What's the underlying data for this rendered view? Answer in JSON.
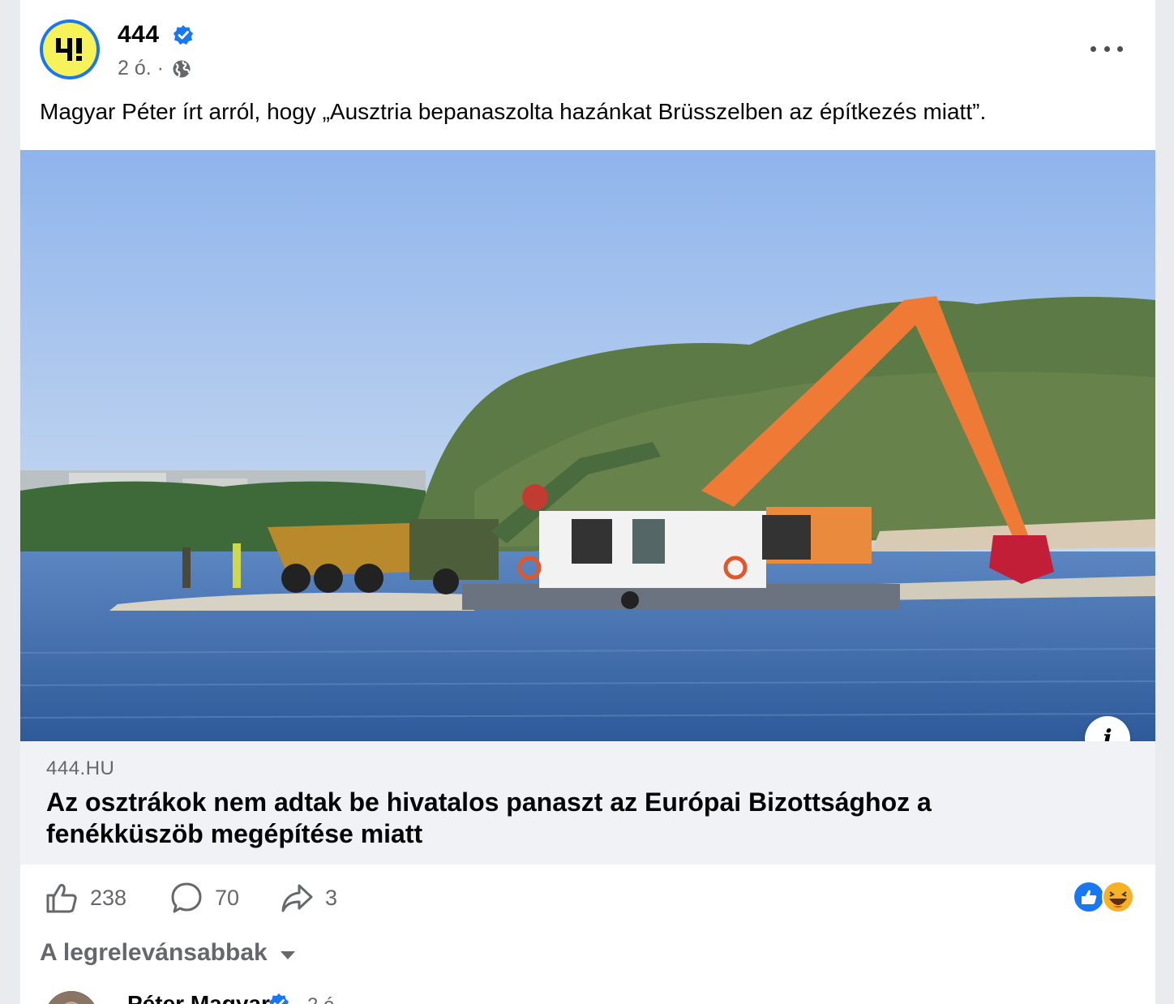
{
  "post": {
    "page_name": "444",
    "logo_text": "4!",
    "time": "2 ó. ·",
    "text": "Magyar Péter írt arról, hogy „Ausztria bepanaszolta hazánkat Brüsszelben az építkezés miatt”."
  },
  "photo": {
    "description_icon": "info-icon"
  },
  "link_preview": {
    "domain": "444.HU",
    "headline": "Az osztrákok nem adtak be hivatalos panaszt az Európai Bizottsághoz a fenékküszöb megépítése miatt",
    "info_glyph": "i"
  },
  "actions": {
    "like_count": "238",
    "comment_count": "70",
    "share_count": "3"
  },
  "reactions": [
    "like",
    "haha"
  ],
  "comments": {
    "sort_label": "A legrelevánsabbak",
    "first_commenter": "Péter Magyar",
    "first_time": "2 ó."
  },
  "colors": {
    "brand_blue": "#1877f2",
    "logo_yellow": "#f5f25a",
    "secondary_text": "#65676b"
  }
}
